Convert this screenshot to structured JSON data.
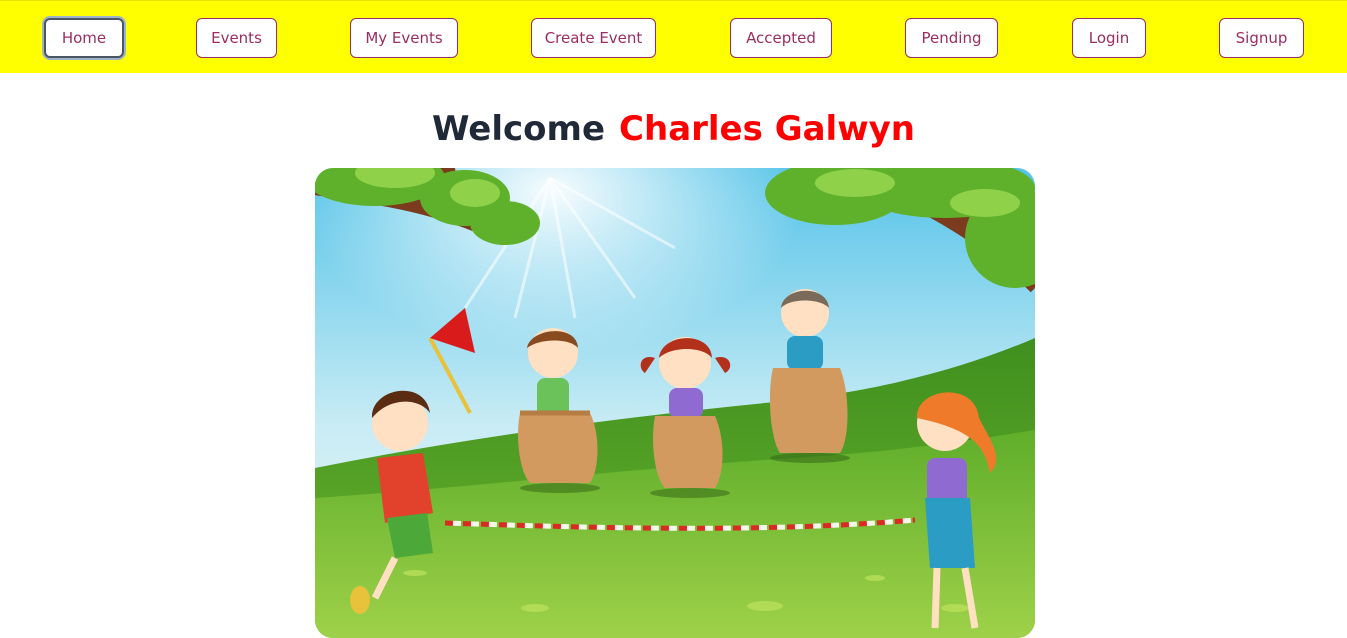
{
  "nav": {
    "items": [
      {
        "label": "Home",
        "active": true
      },
      {
        "label": "Events",
        "active": false
      },
      {
        "label": "My Events",
        "active": false
      },
      {
        "label": "Create Event",
        "active": false
      },
      {
        "label": "Accepted",
        "active": false
      },
      {
        "label": "Pending",
        "active": false
      },
      {
        "label": "Login",
        "active": false
      },
      {
        "label": "Signup",
        "active": false
      }
    ]
  },
  "welcome": {
    "greeting": "Welcome",
    "user_name": "Charles Galwyn"
  },
  "colors": {
    "navbar_bg": "#ffff00",
    "button_text": "#9b2d62",
    "greeting": "#1f2937",
    "user_name": "#ff0000"
  },
  "hero": {
    "icon": "kids-sack-race-illustration"
  }
}
